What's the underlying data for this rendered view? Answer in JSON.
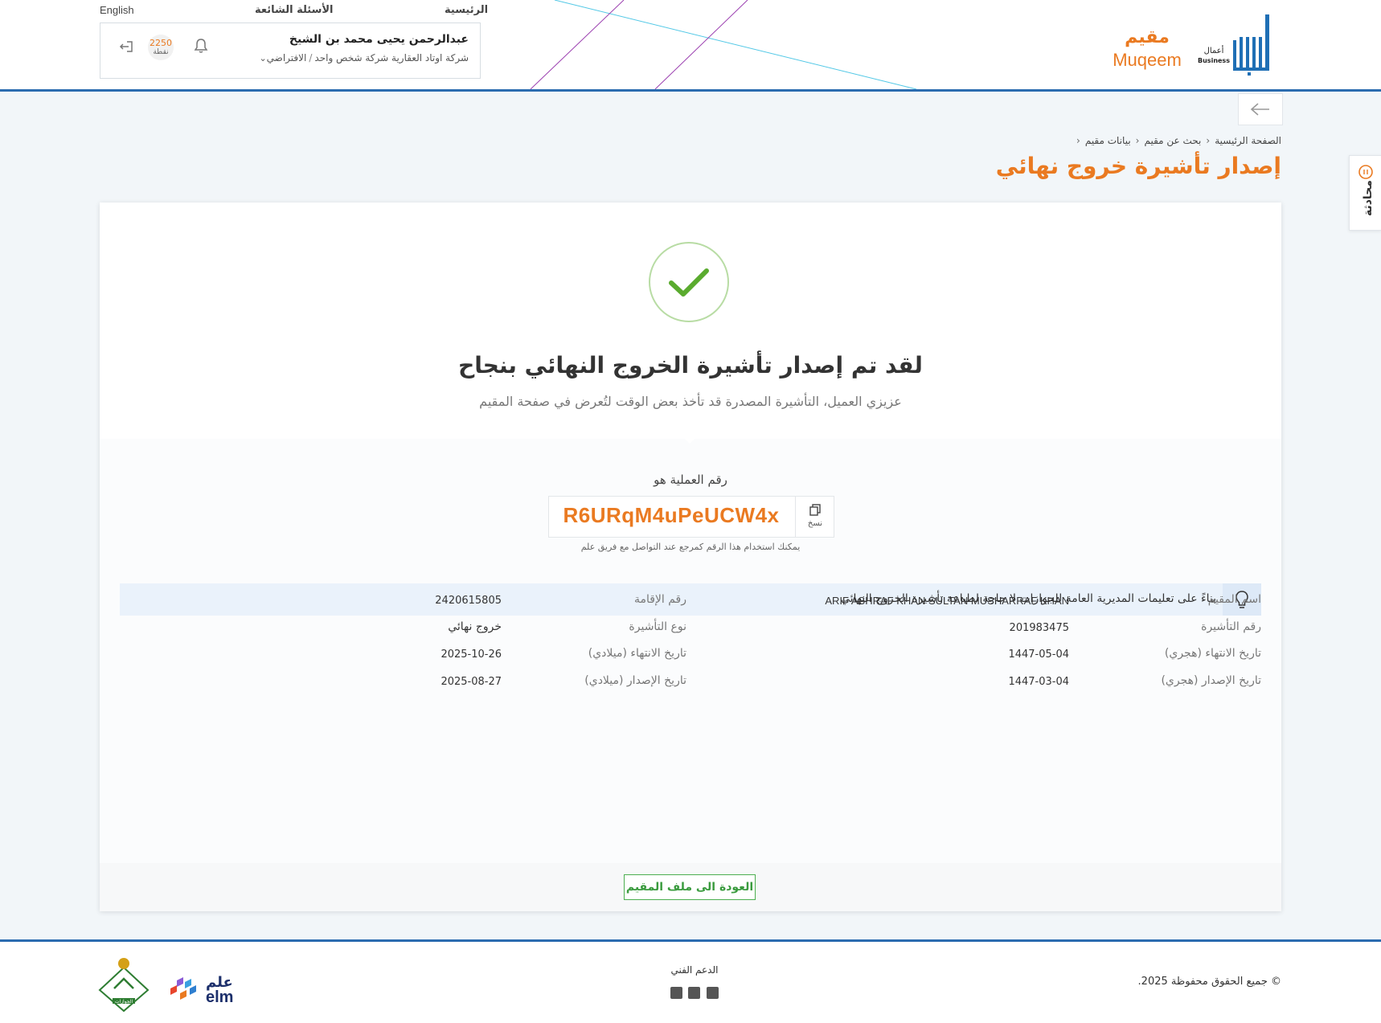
{
  "header": {
    "nav": {
      "home": "الرئيسية",
      "faq": "الأسئلة الشائعة",
      "language": "English"
    },
    "user": {
      "name": "عبدالرحمن يحيى محمد بن الشيخ",
      "company": "شركة اوتاد العقارية شركة شخص واحد",
      "role": "الافتراضي",
      "points_value": "2250",
      "points_label": "نقطة"
    },
    "brand": {
      "muqeem_ar": "مقيم",
      "muqeem_en": "Muqeem",
      "absher_business_ar": "أعمال",
      "absher_business_en": "Business"
    }
  },
  "breadcrumb": [
    "الصفحة الرئيسية",
    "بحث عن مقيم",
    "بيانات مقيم"
  ],
  "page_title": "إصدار تأشيرة خروج نهائي",
  "chat_tab": "محادثة",
  "success": {
    "title": "لقد تم إصدار تأشيرة الخروج النهائي بنجاح",
    "subtitle": "عزيزي العميل، التأشيرة المصدرة قد تأخذ بعض الوقت لتُعرض في صفحة المقيم"
  },
  "operation": {
    "label": "رقم العملية هو",
    "number": "R6URqM4uPeUCW4x",
    "copy_label": "نسخ",
    "hint": "يمكنك استخدام هذا الرقم كمرجع عند التواصل مع فريق علم"
  },
  "info_note": "بناءً على تعليمات المديرية العامة للجوازات لا حاجة لطباعة تأشيرة الخروج النهائي",
  "details": {
    "resident_name_label": "اسم المقيم",
    "resident_name": "ARIF ASHRAF KHAN SULTAN MUSHARRAF KHAN",
    "iqama_label": "رقم الإقامة",
    "iqama": "2420615805",
    "visa_number_label": "رقم التأشيرة",
    "visa_number": "201983475",
    "visa_type_label": "نوع التأشيرة",
    "visa_type": "خروج نهائي",
    "expiry_hijri_label": "تاريخ الانتهاء (هجري)",
    "expiry_hijri": "1447-05-04",
    "expiry_greg_label": "تاريخ الانتهاء (ميلادي)",
    "expiry_greg": "2025-10-26",
    "issue_hijri_label": "تاريخ الإصدار (هجري)",
    "issue_hijri": "1447-03-04",
    "issue_greg_label": "تاريخ الإصدار (ميلادي)",
    "issue_greg": "2025-08-27"
  },
  "return_button": "العودة الى ملف المقيم",
  "footer": {
    "copyright": "© جميع الحقوق محفوظة 2025.",
    "support_label": "الدعم الفني",
    "elm_ar": "علم",
    "elm_en": "elm",
    "jawazat_label": "الجوازات"
  },
  "colors": {
    "accent_orange": "#ea7a21",
    "header_blue": "#2b6cb0",
    "success_green": "#4caf50"
  }
}
